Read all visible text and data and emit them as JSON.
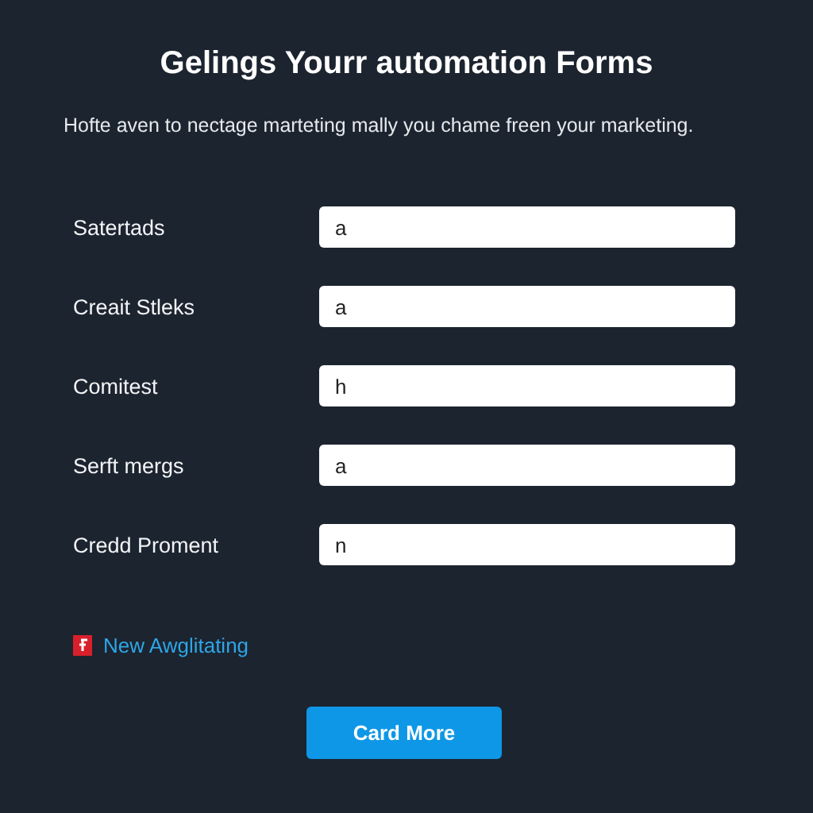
{
  "title": "Gelings Yourr automation Forms",
  "subtitle": "Hofte aven to nectage marteting mally you chame freen your marketing.",
  "fields": [
    {
      "label": "Satertads",
      "value": "a"
    },
    {
      "label": "Creait Stleks",
      "value": "a"
    },
    {
      "label": "Comitest",
      "value": "h"
    },
    {
      "label": "Serft mergs",
      "value": "a"
    },
    {
      "label": "Credd Proment",
      "value": "n"
    }
  ],
  "link": {
    "text": "New Awglitating"
  },
  "button": {
    "label": "Card More"
  }
}
